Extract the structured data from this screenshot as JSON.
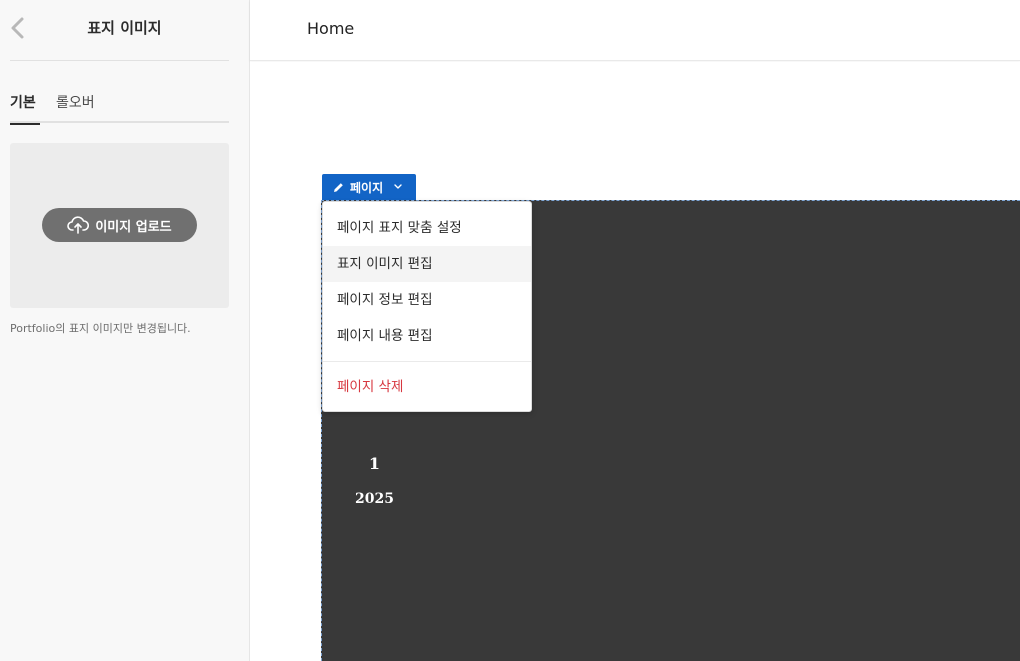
{
  "sidebar": {
    "title": "표지 이미지",
    "tabs": [
      {
        "label": "기본",
        "active": true
      },
      {
        "label": "롤오버",
        "active": false
      }
    ],
    "upload_button_label": "이미지 업로드",
    "note": "Portfolio의 표지 이미지만 변경됩니다."
  },
  "topbar": {
    "title": "Home"
  },
  "page_button": {
    "label": "페이지"
  },
  "menu": {
    "items": [
      {
        "label": "페이지 표지 맞춤 설정"
      },
      {
        "label": "표지 이미지 편집"
      },
      {
        "label": "페이지 정보 편집"
      },
      {
        "label": "페이지 내용 편집"
      },
      {
        "label": "페이지 삭제"
      }
    ]
  },
  "page_cover": {
    "number": "1",
    "year": "2025"
  },
  "colors": {
    "accent": "#1264c6",
    "danger": "#d7373f",
    "cover_background": "#393939",
    "upload_button": "#707070"
  },
  "icons": {
    "back": "chevron-left-icon",
    "upload": "cloud-upload-icon",
    "edit": "pencil-icon",
    "dropdown": "chevron-down-icon"
  }
}
